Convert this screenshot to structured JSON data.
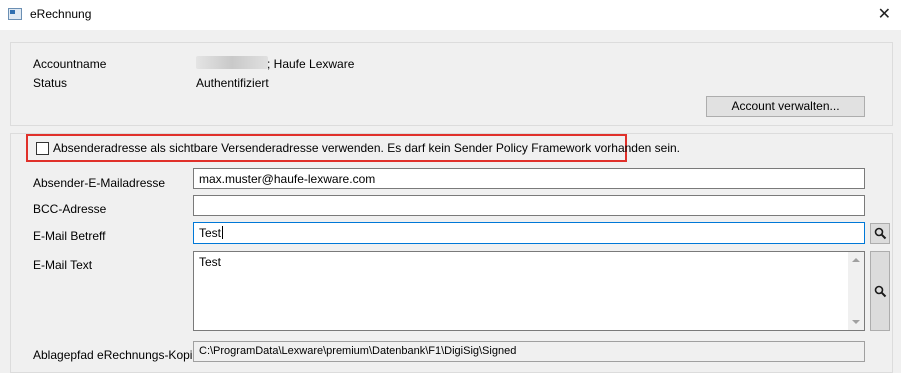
{
  "window": {
    "title": "eRechnung",
    "close_glyph": "✕"
  },
  "account": {
    "name_label": "Accountname",
    "name_value_suffix": "; Haufe Lexware",
    "status_label": "Status",
    "status_value": "Authentifiziert",
    "manage_button": "Account verwalten..."
  },
  "form": {
    "sender_checkbox_label": "Absenderadresse als sichtbare Versenderadresse verwenden. Es darf kein Sender Policy Framework vorhanden sein.",
    "sender_checkbox_checked": false,
    "sender_email_label": "Absender-E-Mailadresse",
    "sender_email_value": "max.muster@haufe-lexware.com",
    "bcc_label": "BCC-Adresse",
    "bcc_value": "",
    "subject_label": "E-Mail Betreff",
    "subject_value": "Test",
    "text_label": "E-Mail Text",
    "text_value": "Test",
    "path_label": "Ablagepfad eRechnungs-Kopien",
    "path_value": "C:\\ProgramData\\Lexware\\premium\\Datenbank\\F1\\DigiSig\\Signed"
  },
  "icons": {
    "window": "window-icon",
    "search": "magnifier-icon",
    "close": "close-icon"
  },
  "colors": {
    "highlight_border": "#e0302a",
    "focus_border": "#0078d7"
  }
}
